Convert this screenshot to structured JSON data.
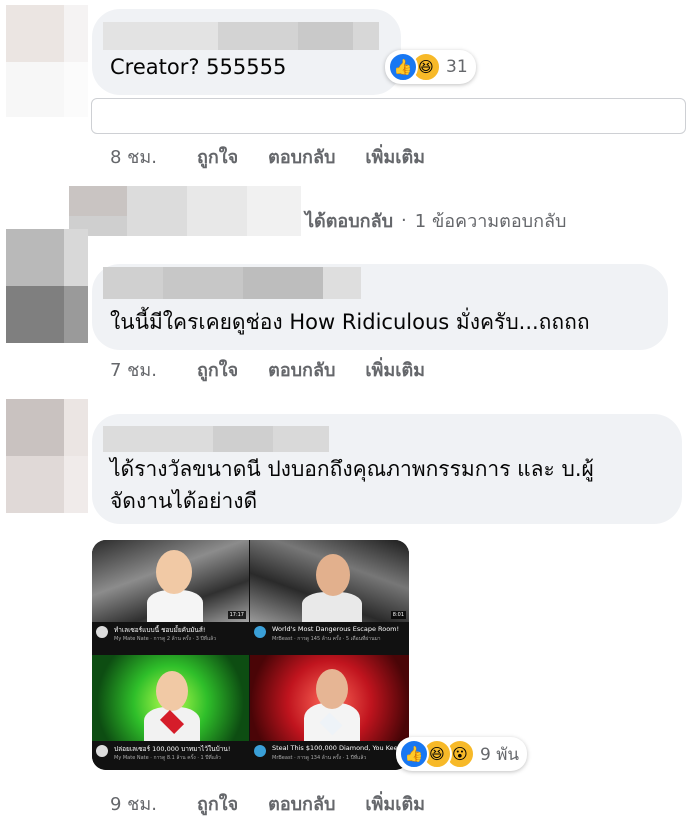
{
  "comment1": {
    "text": "Creator? 555555",
    "reaction_count": "31",
    "reactions": [
      "like-icon",
      "haha-icon"
    ],
    "time": "8 ชม.",
    "like_label": "ถูกใจ",
    "reply_label": "ตอบกลับ",
    "more_label": "เพิ่มเติม"
  },
  "reply_thread": {
    "replied_text": "ได้ตอบกลับ",
    "separator": "·",
    "count_text": "1 ข้อความตอบกลับ"
  },
  "comment2": {
    "text": "ในนี้มีใครเคยดูช่อง How Ridiculous มั่งครับ...ถถถถ",
    "time": "7 ชม.",
    "like_label": "ถูกใจ",
    "reply_label": "ตอบกลับ",
    "more_label": "เพิ่มเติม"
  },
  "comment3": {
    "text_line1": "ได้รางวัลขนาดนี ปงบอกถึงคุณภาพกรรมการ และ บ.ผู้",
    "text_line2": "จัดงานได้อย่างดี",
    "reaction_count": "9 พัน",
    "reactions": [
      "like-icon",
      "haha-icon",
      "wow-icon"
    ],
    "time": "9 ชม.",
    "like_label": "ถูกใจ",
    "reply_label": "ตอบกลับ",
    "more_label": "เพิ่มเติม",
    "image": {
      "videos": [
        {
          "title": "ทำเลเซอร์แบบนี้ ชอบมั้ยคับมันส์!",
          "sub": "My Mate Nate · การดู 2 ล้าน ครั้ง · 3 ปีที่แล้ว",
          "duration": "17:17"
        },
        {
          "title": "World's Most Dangerous Escape Room!",
          "sub": "MrBeast · การดู 145 ล้าน ครั้ง · 5 เดือนที่ผ่านมา",
          "duration": "8:01"
        },
        {
          "title": "ปล่อยเลเซอร์ 100,000 บาทมาไว้ในบ้าน!",
          "sub": "My Mate Nate · การดู 8.1 ล้าน ครั้ง · 1 ปีที่แล้ว",
          "duration": ""
        },
        {
          "title": "Steal This $100,000 Diamond, You Keep It",
          "sub": "MrBeast · การดู 134 ล้าน ครั้ง · 1 ปีที่แล้ว",
          "duration": ""
        }
      ]
    }
  },
  "colors": {
    "bubble": "#f0f2f5",
    "meta_text": "#65676b",
    "like_blue": "#1877f2",
    "emoji_yellow": "#f7b928"
  }
}
